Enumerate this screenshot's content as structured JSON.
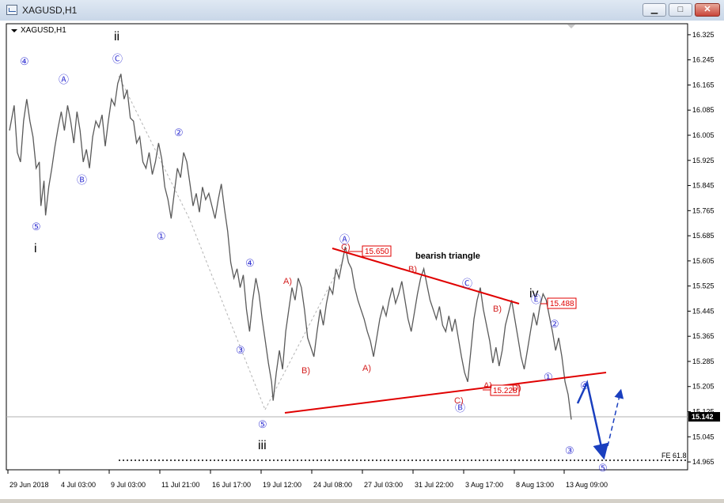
{
  "window": {
    "title": "XAGUSD,H1",
    "min_glyph": "▁",
    "max_glyph": "□",
    "close_glyph": "✕"
  },
  "chart_data": {
    "type": "line",
    "symbol_label": "XAGUSD,H1",
    "title": "",
    "xlabel": "",
    "ylabel": "",
    "ylim": [
      14.94,
      16.36
    ],
    "y_ticks": [
      "16.325",
      "16.245",
      "16.165",
      "16.085",
      "16.005",
      "15.925",
      "15.845",
      "15.765",
      "15.685",
      "15.605",
      "15.525",
      "15.445",
      "15.365",
      "15.285",
      "15.205",
      "15.125",
      "15.045",
      "14.965"
    ],
    "x_ticks": [
      "29 Jun 2018",
      "4 Jul 03:00",
      "9 Jul 03:00",
      "11 Jul 21:00",
      "16 Jul 17:00",
      "19 Jul 12:00",
      "24 Jul 08:00",
      "27 Jul 03:00",
      "31 Jul 22:00",
      "3 Aug 17:00",
      "8 Aug 13:00",
      "13 Aug 09:00"
    ],
    "current_price": "15.142",
    "series": [
      {
        "values": [
          [
            0,
            16.02
          ],
          [
            3,
            16.1
          ],
          [
            5,
            15.95
          ],
          [
            7,
            15.92
          ],
          [
            9,
            16.05
          ],
          [
            11,
            16.12
          ],
          [
            13,
            16.05
          ],
          [
            15,
            16.0
          ],
          [
            17,
            15.9
          ],
          [
            19,
            15.92
          ],
          [
            20,
            15.78
          ],
          [
            22,
            15.86
          ],
          [
            23,
            15.75
          ],
          [
            25,
            15.84
          ],
          [
            27,
            15.9
          ],
          [
            29,
            15.97
          ],
          [
            31,
            16.03
          ],
          [
            33,
            16.08
          ],
          [
            35,
            16.02
          ],
          [
            37,
            16.1
          ],
          [
            39,
            16.05
          ],
          [
            41,
            15.98
          ],
          [
            43,
            16.08
          ],
          [
            45,
            16.02
          ],
          [
            47,
            15.92
          ],
          [
            49,
            15.96
          ],
          [
            51,
            15.9
          ],
          [
            53,
            16.0
          ],
          [
            55,
            16.05
          ],
          [
            57,
            16.03
          ],
          [
            59,
            16.07
          ],
          [
            61,
            15.97
          ],
          [
            63,
            16.05
          ],
          [
            65,
            16.12
          ],
          [
            67,
            16.1
          ],
          [
            69,
            16.17
          ],
          [
            71,
            16.2
          ],
          [
            73,
            16.12
          ],
          [
            75,
            16.15
          ],
          [
            77,
            16.06
          ],
          [
            79,
            16.05
          ],
          [
            81,
            15.98
          ],
          [
            83,
            16.0
          ],
          [
            85,
            15.92
          ],
          [
            87,
            15.9
          ],
          [
            89,
            15.95
          ],
          [
            91,
            15.88
          ],
          [
            93,
            15.92
          ],
          [
            95,
            15.98
          ],
          [
            97,
            15.93
          ],
          [
            99,
            15.84
          ],
          [
            101,
            15.8
          ],
          [
            103,
            15.74
          ],
          [
            105,
            15.82
          ],
          [
            107,
            15.9
          ],
          [
            109,
            15.87
          ],
          [
            111,
            15.95
          ],
          [
            113,
            15.92
          ],
          [
            115,
            15.85
          ],
          [
            117,
            15.78
          ],
          [
            119,
            15.82
          ],
          [
            121,
            15.76
          ],
          [
            123,
            15.84
          ],
          [
            125,
            15.8
          ],
          [
            127,
            15.82
          ],
          [
            129,
            15.78
          ],
          [
            131,
            15.74
          ],
          [
            133,
            15.8
          ],
          [
            135,
            15.85
          ],
          [
            137,
            15.77
          ],
          [
            139,
            15.7
          ],
          [
            141,
            15.6
          ],
          [
            143,
            15.55
          ],
          [
            145,
            15.58
          ],
          [
            147,
            15.52
          ],
          [
            149,
            15.56
          ],
          [
            151,
            15.45
          ],
          [
            153,
            15.38
          ],
          [
            155,
            15.48
          ],
          [
            157,
            15.55
          ],
          [
            159,
            15.5
          ],
          [
            161,
            15.42
          ],
          [
            163,
            15.35
          ],
          [
            165,
            15.28
          ],
          [
            167,
            15.22
          ],
          [
            168,
            15.16
          ],
          [
            170,
            15.25
          ],
          [
            172,
            15.32
          ],
          [
            174,
            15.26
          ],
          [
            176,
            15.38
          ],
          [
            178,
            15.45
          ],
          [
            180,
            15.52
          ],
          [
            182,
            15.48
          ],
          [
            184,
            15.55
          ],
          [
            186,
            15.52
          ],
          [
            188,
            15.45
          ],
          [
            190,
            15.36
          ],
          [
            192,
            15.33
          ],
          [
            194,
            15.3
          ],
          [
            196,
            15.38
          ],
          [
            198,
            15.45
          ],
          [
            200,
            15.4
          ],
          [
            202,
            15.47
          ],
          [
            204,
            15.52
          ],
          [
            206,
            15.5
          ],
          [
            208,
            15.58
          ],
          [
            210,
            15.55
          ],
          [
            212,
            15.6
          ],
          [
            214,
            15.65
          ],
          [
            216,
            15.6
          ],
          [
            218,
            15.58
          ],
          [
            220,
            15.52
          ],
          [
            222,
            15.48
          ],
          [
            224,
            15.45
          ],
          [
            226,
            15.42
          ],
          [
            228,
            15.38
          ],
          [
            230,
            15.35
          ],
          [
            232,
            15.3
          ],
          [
            234,
            15.36
          ],
          [
            236,
            15.42
          ],
          [
            238,
            15.46
          ],
          [
            240,
            15.43
          ],
          [
            242,
            15.48
          ],
          [
            244,
            15.52
          ],
          [
            246,
            15.47
          ],
          [
            248,
            15.5
          ],
          [
            250,
            15.54
          ],
          [
            252,
            15.48
          ],
          [
            254,
            15.42
          ],
          [
            256,
            15.38
          ],
          [
            258,
            15.44
          ],
          [
            260,
            15.5
          ],
          [
            262,
            15.55
          ],
          [
            264,
            15.58
          ],
          [
            266,
            15.53
          ],
          [
            268,
            15.48
          ],
          [
            270,
            15.45
          ],
          [
            272,
            15.42
          ],
          [
            274,
            15.46
          ],
          [
            276,
            15.4
          ],
          [
            278,
            15.38
          ],
          [
            280,
            15.43
          ],
          [
            282,
            15.38
          ],
          [
            284,
            15.42
          ],
          [
            286,
            15.36
          ],
          [
            288,
            15.3
          ],
          [
            290,
            15.25
          ],
          [
            292,
            15.22
          ],
          [
            294,
            15.32
          ],
          [
            296,
            15.42
          ],
          [
            298,
            15.48
          ],
          [
            300,
            15.52
          ],
          [
            302,
            15.45
          ],
          [
            304,
            15.4
          ],
          [
            306,
            15.35
          ],
          [
            308,
            15.28
          ],
          [
            310,
            15.33
          ],
          [
            312,
            15.27
          ],
          [
            314,
            15.32
          ],
          [
            316,
            15.4
          ],
          [
            318,
            15.44
          ],
          [
            320,
            15.48
          ],
          [
            322,
            15.42
          ],
          [
            324,
            15.36
          ],
          [
            326,
            15.3
          ],
          [
            328,
            15.26
          ],
          [
            330,
            15.32
          ],
          [
            332,
            15.38
          ],
          [
            334,
            15.44
          ],
          [
            336,
            15.4
          ],
          [
            338,
            15.46
          ],
          [
            340,
            15.5
          ],
          [
            342,
            15.48
          ],
          [
            344,
            15.43
          ],
          [
            346,
            15.38
          ],
          [
            348,
            15.32
          ],
          [
            350,
            15.36
          ],
          [
            352,
            15.3
          ],
          [
            354,
            15.22
          ],
          [
            356,
            15.18
          ],
          [
            358,
            15.1
          ]
        ]
      }
    ],
    "annotations": {
      "fe_label": "FE 61.8",
      "triangle_label": "bearish triangle",
      "price_boxes": [
        "15.650",
        "15.488",
        "15.228"
      ],
      "wave_labels_black": [
        "ii",
        "i",
        "iii",
        "iv"
      ],
      "wave_labels_blue": [
        "④",
        "Ⓐ",
        "Ⓒ",
        "⑤",
        "Ⓑ",
        "②",
        "①",
        "④",
        "③",
        "⑤",
        "Ⓐ",
        "Ⓒ",
        "Ⓑ",
        "Ⓔ",
        "②",
        "①",
        "④",
        "③",
        "⑤"
      ],
      "wave_labels_red": [
        "A)",
        "B)",
        "A)",
        "C)",
        "B)",
        "C)",
        "B)",
        "A)",
        "D)"
      ]
    }
  }
}
